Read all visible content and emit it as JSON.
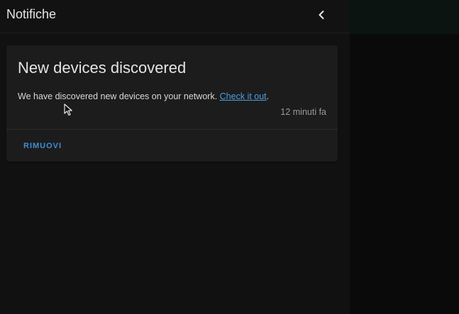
{
  "drawer": {
    "title": "Notifiche",
    "close_icon": "chevron-left-icon"
  },
  "notification": {
    "title": "New devices discovered",
    "message_text": "We have discovered new devices on your network. ",
    "link_text": "Check it out",
    "message_suffix": ".",
    "timestamp": "12 minuti fa",
    "action_label": "RIMUOVI"
  },
  "colors": {
    "background": "#111111",
    "card": "#1c1c1c",
    "link": "#4d9fe0",
    "action": "#3d8fd6"
  },
  "cursor_icon": "mouse-pointer-icon"
}
